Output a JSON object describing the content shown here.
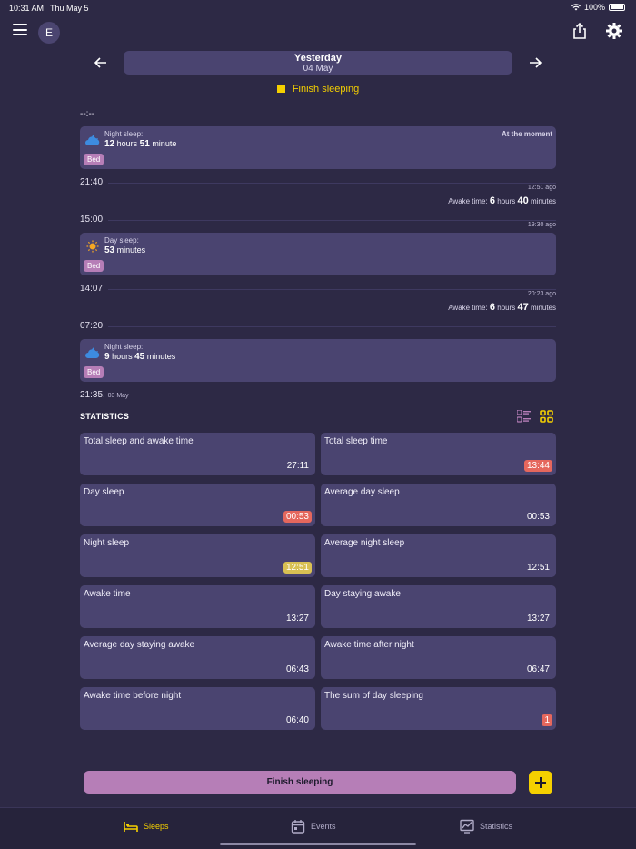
{
  "status_bar": {
    "time": "10:31 AM",
    "date": "Thu May 5",
    "battery": "100%"
  },
  "header": {
    "avatar_letter": "E"
  },
  "date_nav": {
    "title": "Yesterday",
    "subtitle": "04 May"
  },
  "finish_indicator": "Finish sleeping",
  "timeline": {
    "top_time": "--:--",
    "entries": [
      {
        "label": "Night sleep:",
        "hours": "12",
        "hours_unit": "hours",
        "minutes": "51",
        "minutes_unit": "minute",
        "moment": "At the moment",
        "tag": "Bed"
      },
      {
        "label": "Day sleep:",
        "minutes": "53",
        "minutes_unit": "minutes",
        "tag": "Bed"
      },
      {
        "label": "Night sleep:",
        "hours": "9",
        "hours_unit": "hours",
        "minutes": "45",
        "minutes_unit": "minutes",
        "tag": "Bed"
      }
    ],
    "times": [
      {
        "time": "21:40",
        "ago": "12:51 ago"
      },
      {
        "time": "15:00",
        "ago": "19:30 ago"
      },
      {
        "time": "14:07",
        "ago": "20:23 ago"
      },
      {
        "time": "07:20"
      },
      {
        "time": "21:35,",
        "small": "03 May"
      }
    ],
    "awake": [
      {
        "label": "Awake time:",
        "hours": "6",
        "hours_unit": "hours",
        "minutes": "40",
        "minutes_unit": "minutes"
      },
      {
        "label": "Awake time:",
        "hours": "6",
        "hours_unit": "hours",
        "minutes": "47",
        "minutes_unit": "minutes"
      }
    ]
  },
  "statistics": {
    "title": "STATISTICS",
    "cards": [
      {
        "title": "Total sleep and awake time",
        "value": "27:11",
        "highlight": ""
      },
      {
        "title": "Total sleep time",
        "value": "13:44",
        "highlight": "red"
      },
      {
        "title": "Day sleep",
        "value": "00:53",
        "highlight": "red"
      },
      {
        "title": "Average day sleep",
        "value": "00:53",
        "highlight": ""
      },
      {
        "title": "Night sleep",
        "value": "12:51",
        "highlight": "yellow"
      },
      {
        "title": "Average night sleep",
        "value": "12:51",
        "highlight": ""
      },
      {
        "title": "Awake time",
        "value": "13:27",
        "highlight": ""
      },
      {
        "title": "Day staying awake",
        "value": "13:27",
        "highlight": ""
      },
      {
        "title": "Average day staying awake",
        "value": "06:43",
        "highlight": ""
      },
      {
        "title": "Awake time after night",
        "value": "06:47",
        "highlight": ""
      },
      {
        "title": "Awake time before night",
        "value": "06:40",
        "highlight": ""
      },
      {
        "title": "The sum of day sleeping",
        "value": "1",
        "highlight": "red"
      }
    ]
  },
  "bottom": {
    "action_label": "Finish sleeping"
  },
  "tabs": [
    {
      "label": "Sleeps",
      "active": true
    },
    {
      "label": "Events",
      "active": false
    },
    {
      "label": "Statistics",
      "active": false
    }
  ],
  "colors": {
    "accent": "#f5d000",
    "card": "#4a4470",
    "background": "#2d2945",
    "tag": "#b67eb7",
    "red": "#e5675d",
    "yellow": "#d8c053"
  }
}
